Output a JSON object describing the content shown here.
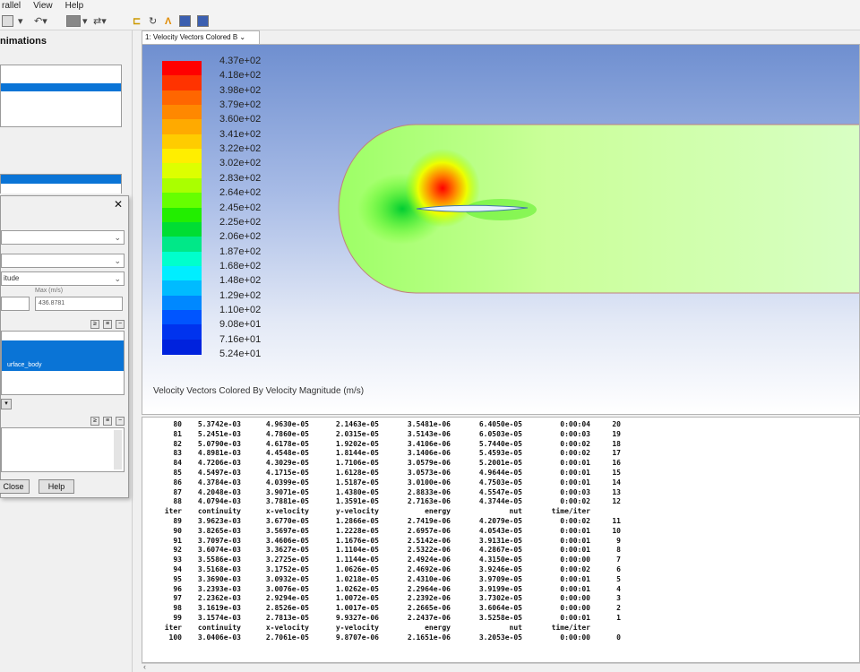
{
  "menu": {
    "items": [
      "rallel",
      "View",
      "Help"
    ]
  },
  "left_panel": {
    "title": "nimations",
    "close_glyph": "✕"
  },
  "dialog": {
    "dropdown_2": "",
    "dropdown_3": "itude",
    "min_value": "",
    "max_label": "Max (m/s)",
    "max_value": "436.8781",
    "surface_item": "urface_body",
    "close_label": "Close",
    "help_label": "Help"
  },
  "graphics": {
    "tab_label": "1: Velocity Vectors Colored B",
    "caption": "Velocity Vectors Colored By Velocity Magnitude (m/s)",
    "colorbar_labels": [
      "4.37e+02",
      "4.18e+02",
      "3.98e+02",
      "3.79e+02",
      "3.60e+02",
      "3.41e+02",
      "3.22e+02",
      "3.02e+02",
      "2.83e+02",
      "2.64e+02",
      "2.45e+02",
      "2.25e+02",
      "2.06e+02",
      "1.87e+02",
      "1.68e+02",
      "1.48e+02",
      "1.29e+02",
      "1.10e+02",
      "9.08e+01",
      "7.16e+01",
      "5.24e+01"
    ],
    "colors": [
      "#ff0000",
      "#ff3300",
      "#ff6600",
      "#ff8800",
      "#ffaa00",
      "#ffcc00",
      "#ffee00",
      "#ddff00",
      "#aaff00",
      "#66ff00",
      "#22ee00",
      "#00dd33",
      "#00e888",
      "#00ffcc",
      "#00eeff",
      "#00bbff",
      "#0088ff",
      "#0055ff",
      "#0033ee",
      "#0022dd"
    ]
  },
  "console": {
    "rows": [
      [
        "80",
        "5.3742e-03",
        "4.9630e-05",
        "2.1463e-05",
        "3.5481e-06",
        "6.4050e-05",
        "0:00:04",
        "20"
      ],
      [
        "81",
        "5.2451e-03",
        "4.7860e-05",
        "2.0315e-05",
        "3.5143e-06",
        "6.0503e-05",
        "0:00:03",
        "19"
      ],
      [
        "82",
        "5.0790e-03",
        "4.6178e-05",
        "1.9202e-05",
        "3.4106e-06",
        "5.7440e-05",
        "0:00:02",
        "18"
      ],
      [
        "83",
        "4.8981e-03",
        "4.4548e-05",
        "1.8144e-05",
        "3.1406e-06",
        "5.4593e-05",
        "0:00:02",
        "17"
      ],
      [
        "84",
        "4.7206e-03",
        "4.3029e-05",
        "1.7106e-05",
        "3.0579e-06",
        "5.2001e-05",
        "0:00:01",
        "16"
      ],
      [
        "85",
        "4.5497e-03",
        "4.1715e-05",
        "1.6128e-05",
        "3.0573e-06",
        "4.9644e-05",
        "0:00:01",
        "15"
      ],
      [
        "86",
        "4.3784e-03",
        "4.0399e-05",
        "1.5187e-05",
        "3.0100e-06",
        "4.7503e-05",
        "0:00:01",
        "14"
      ],
      [
        "87",
        "4.2048e-03",
        "3.9071e-05",
        "1.4380e-05",
        "2.8833e-06",
        "4.5547e-05",
        "0:00:03",
        "13"
      ],
      [
        "88",
        "4.0794e-03",
        "3.7881e-05",
        "1.3591e-05",
        "2.7163e-06",
        "4.3744e-05",
        "0:00:02",
        "12"
      ],
      [
        "iter",
        "continuity",
        "x-velocity",
        "y-velocity",
        "energy",
        "nut",
        "time/iter",
        ""
      ],
      [
        "89",
        "3.9623e-03",
        "3.6770e-05",
        "1.2866e-05",
        "2.7419e-06",
        "4.2079e-05",
        "0:00:02",
        "11"
      ],
      [
        "90",
        "3.8265e-03",
        "3.5697e-05",
        "1.2228e-05",
        "2.6957e-06",
        "4.0543e-05",
        "0:00:01",
        "10"
      ],
      [
        "91",
        "3.7097e-03",
        "3.4606e-05",
        "1.1676e-05",
        "2.5142e-06",
        "3.9131e-05",
        "0:00:01",
        "9"
      ],
      [
        "92",
        "3.6074e-03",
        "3.3627e-05",
        "1.1104e-05",
        "2.5322e-06",
        "4.2867e-05",
        "0:00:01",
        "8"
      ],
      [
        "93",
        "3.5586e-03",
        "3.2725e-05",
        "1.1144e-05",
        "2.4924e-06",
        "4.3150e-05",
        "0:00:00",
        "7"
      ],
      [
        "94",
        "3.5168e-03",
        "3.1752e-05",
        "1.0626e-05",
        "2.4692e-06",
        "3.9246e-05",
        "0:00:02",
        "6"
      ],
      [
        "95",
        "3.3690e-03",
        "3.0932e-05",
        "1.0218e-05",
        "2.4310e-06",
        "3.9709e-05",
        "0:00:01",
        "5"
      ],
      [
        "96",
        "3.2393e-03",
        "3.0076e-05",
        "1.0262e-05",
        "2.2964e-06",
        "3.9199e-05",
        "0:00:01",
        "4"
      ],
      [
        "97",
        "2.2362e-03",
        "2.9294e-05",
        "1.0072e-05",
        "2.2392e-06",
        "3.7302e-05",
        "0:00:00",
        "3"
      ],
      [
        "98",
        "3.1619e-03",
        "2.8526e-05",
        "1.0017e-05",
        "2.2665e-06",
        "3.6064e-05",
        "0:00:00",
        "2"
      ],
      [
        "99",
        "3.1574e-03",
        "2.7813e-05",
        "9.9327e-06",
        "2.2437e-06",
        "3.5258e-05",
        "0:00:01",
        "1"
      ],
      [
        "iter",
        "continuity",
        "x-velocity",
        "y-velocity",
        "energy",
        "nut",
        "time/iter",
        ""
      ],
      [
        "100",
        "3.0406e-03",
        "2.7061e-05",
        "9.8707e-06",
        "2.1651e-06",
        "3.2053e-05",
        "0:00:00",
        "0"
      ]
    ]
  }
}
